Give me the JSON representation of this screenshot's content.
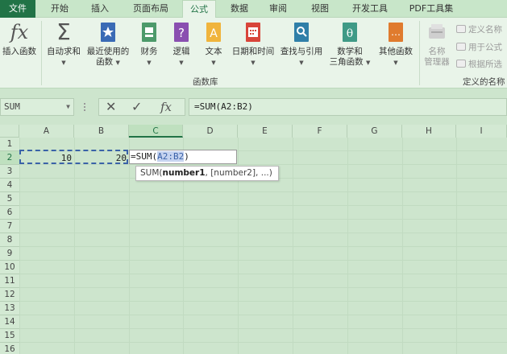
{
  "tabs": [
    "文件",
    "开始",
    "插入",
    "页面布局",
    "公式",
    "数据",
    "审阅",
    "视图",
    "开发工具",
    "PDF工具集"
  ],
  "ribbon": {
    "buttons": [
      {
        "label": "插入函数",
        "icon": "fx-icon"
      },
      {
        "label": "自动求和",
        "icon": "sigma-icon"
      },
      {
        "label": "最近使用的",
        "label2": "函数",
        "icon": "star-book-icon"
      },
      {
        "label": "财务",
        "icon": "finance-book-icon"
      },
      {
        "label": "逻辑",
        "icon": "question-book-icon"
      },
      {
        "label": "文本",
        "icon": "text-book-icon"
      },
      {
        "label": "日期和时间",
        "icon": "calendar-book-icon"
      },
      {
        "label": "查找与引用",
        "icon": "search-book-icon"
      },
      {
        "label": "数学和",
        "label2": "三角函数",
        "icon": "theta-book-icon"
      },
      {
        "label": "其他函数",
        "icon": "more-book-icon"
      }
    ],
    "group_label": "函数库",
    "name_manager": {
      "label": "名称",
      "label2": "管理器"
    },
    "defined_names": [
      "定义名称",
      "用于公式",
      "根据所选"
    ],
    "defined_group_label": "定义的名称"
  },
  "formula_bar": {
    "name_box": "SUM",
    "cancel": "✕",
    "enter": "✓",
    "fx": "fx",
    "formula": "=SUM(A2:B2)"
  },
  "sheet": {
    "columns": [
      "A",
      "B",
      "C",
      "D",
      "E",
      "F",
      "G",
      "H",
      "I"
    ],
    "rows": [
      "1",
      "2",
      "3",
      "4",
      "5",
      "6",
      "7",
      "8",
      "9",
      "10",
      "11",
      "12",
      "13",
      "14",
      "15",
      "16"
    ],
    "cells": {
      "A2": "10",
      "B2": "20"
    },
    "edit": {
      "prefix": "=SUM(",
      "ref": "A2:B2",
      "suffix": ")"
    },
    "tooltip": {
      "fn": "SUM(",
      "arg1": "number1",
      "rest": ", [number2], ...)"
    }
  },
  "colors": {
    "accent": "#217346",
    "ref": "#3a62a8"
  }
}
